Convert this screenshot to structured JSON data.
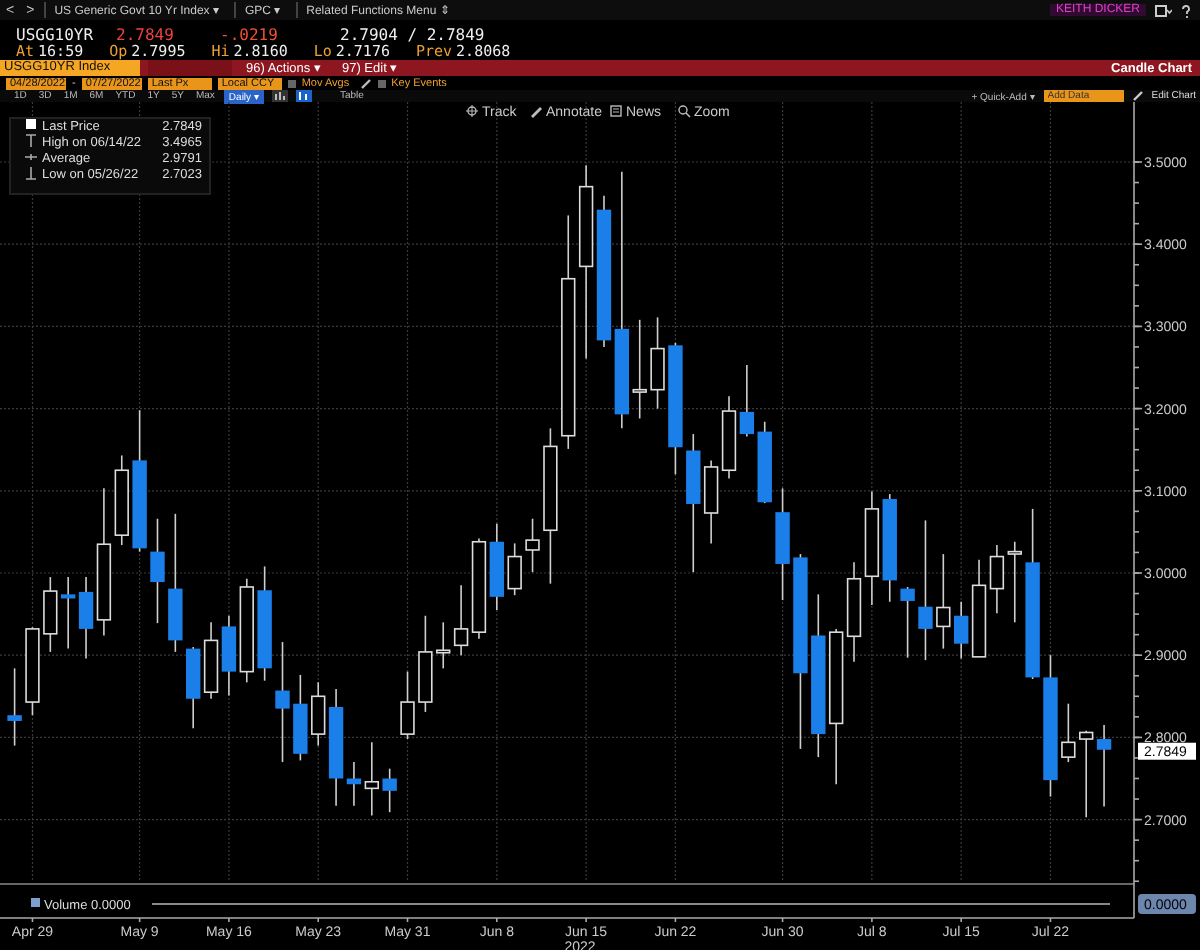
{
  "nav": {
    "back": "<",
    "forward": ">",
    "menus": [
      {
        "label": "US Generic Govt 10 Yr Index ▾"
      },
      {
        "label": "GPC ▾"
      },
      {
        "label": "Related Functions Menu ⇕"
      }
    ],
    "user": "KEITH DICKER"
  },
  "quote": {
    "ticker": "USGG10YR",
    "last": "2.7849",
    "change": "-.0219",
    "bid_ask": "2.7904 / 2.7849",
    "fields": [
      {
        "label": "At",
        "value": "16:59"
      },
      {
        "label": "Op",
        "value": "2.7995"
      },
      {
        "label": "Hi",
        "value": "2.8160"
      },
      {
        "label": "Lo",
        "value": "2.7176"
      },
      {
        "label": "Prev",
        "value": "2.8068"
      }
    ]
  },
  "command_bar": {
    "security": "USGG10YR Index",
    "actions": "96) Actions ▾",
    "edit": "97) Edit ▾",
    "title": "Candle Chart"
  },
  "settings": {
    "start_date": "04/28/2022",
    "separator": "-",
    "end_date": "07/27/2022",
    "price": "Last Px",
    "currency": "Local CCY",
    "toggles": [
      {
        "label": "Mov Avgs",
        "checked": false
      },
      {
        "label": "Key Events",
        "checked": false
      }
    ]
  },
  "periods": [
    {
      "label": "1D",
      "selected": false
    },
    {
      "label": "3D",
      "selected": false
    },
    {
      "label": "1M",
      "selected": false
    },
    {
      "label": "6M",
      "selected": false
    },
    {
      "label": "YTD",
      "selected": false
    },
    {
      "label": "1Y",
      "selected": false
    },
    {
      "label": "5Y",
      "selected": false
    },
    {
      "label": "Max",
      "selected": false
    }
  ],
  "frequency": "Daily ▾",
  "table": "Table",
  "quick_add": "+ Quick-Add ▾",
  "add_data": {
    "placeholder": "Add Data"
  },
  "edit_chart": "Edit Chart",
  "chart_tools": [
    "Track",
    "Annotate",
    "News",
    "Zoom"
  ],
  "legend": [
    {
      "kind": "last",
      "label": "Last Price",
      "value": "2.7849"
    },
    {
      "kind": "high",
      "label": "High on 06/14/22",
      "value": "3.4965"
    },
    {
      "kind": "average",
      "label": "Average",
      "value": "2.9791"
    },
    {
      "kind": "low",
      "label": "Low on 05/26/22",
      "value": "2.7023"
    }
  ],
  "y_axis": {
    "labels": [
      "3.5000",
      "3.4000",
      "3.3000",
      "3.2000",
      "3.1000",
      "3.0000",
      "2.9000",
      "2.8000",
      "2.7000"
    ]
  },
  "x_axis": {
    "labels": [
      "Apr 29",
      "May 9",
      "May 16",
      "May 23",
      "May 31",
      "Jun 8",
      "Jun 15",
      "Jun 22",
      "Jun 30",
      "Jul 8",
      "Jul 15",
      "Jul 22"
    ],
    "year": "2022"
  },
  "last_price_tag": "2.7849",
  "volume": {
    "label": "Volume 0.0000",
    "axis_value": "0.0000"
  }
}
